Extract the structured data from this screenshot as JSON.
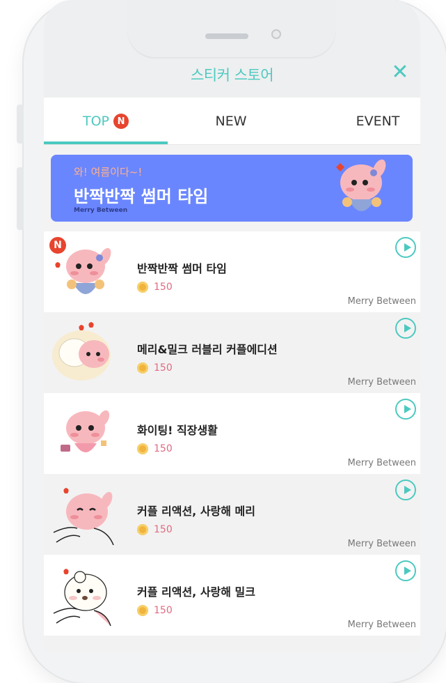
{
  "header": {
    "title": "스티커 스토어",
    "close_icon": "close-icon"
  },
  "tabs": [
    {
      "label": "TOP",
      "badge": "N",
      "active": true
    },
    {
      "label": "NEW",
      "active": false
    },
    {
      "label": "EVENT",
      "active": false
    }
  ],
  "banner": {
    "small_text": "와! 여름이다~!",
    "title": "반짝반짝 썸머 타임",
    "brand": "Merry Between",
    "background": "#6a86ff"
  },
  "items": [
    {
      "name": "반짝반짝 썸머 타임",
      "price": "150",
      "brand": "Merry Between",
      "new_badge": "N"
    },
    {
      "name": "메리&밀크 러블리 커플에디션",
      "price": "150",
      "brand": "Merry Between"
    },
    {
      "name": "화이팅! 직장생활",
      "price": "150",
      "brand": "Merry Between"
    },
    {
      "name": "커플 리액션, 사랑해 메리",
      "price": "150",
      "brand": "Merry Between"
    },
    {
      "name": "커플 리액션, 사랑해 밀크",
      "price": "150",
      "brand": "Merry Between"
    }
  ],
  "colors": {
    "accent": "#4cc9c0",
    "badge_red": "#e8442e",
    "price_pink": "#e06a82"
  }
}
